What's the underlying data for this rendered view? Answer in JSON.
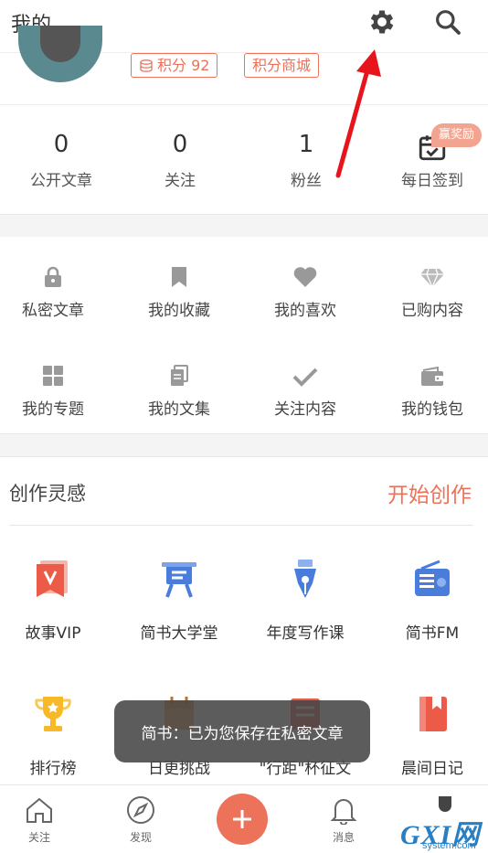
{
  "header": {
    "title": "我的"
  },
  "profile": {
    "points_label": "积分 92",
    "mall_label": "积分商城"
  },
  "stats": [
    {
      "value": "0",
      "label": "公开文章"
    },
    {
      "value": "0",
      "label": "关注"
    },
    {
      "value": "1",
      "label": "粉丝"
    },
    {
      "value": "",
      "label": "每日签到"
    }
  ],
  "reward_badge": "赢奖励",
  "grid": [
    {
      "label": "私密文章",
      "icon": "lock-icon"
    },
    {
      "label": "我的收藏",
      "icon": "bookmark-icon"
    },
    {
      "label": "我的喜欢",
      "icon": "heart-icon"
    },
    {
      "label": "已购内容",
      "icon": "diamond-icon"
    },
    {
      "label": "我的专题",
      "icon": "grid-icon"
    },
    {
      "label": "我的文集",
      "icon": "documents-icon"
    },
    {
      "label": "关注内容",
      "icon": "check-icon"
    },
    {
      "label": "我的钱包",
      "icon": "wallet-icon"
    }
  ],
  "inspiration": {
    "title": "创作灵感",
    "start_label": "开始创作",
    "items": [
      {
        "label": "故事VIP",
        "icon": "vip-book-icon"
      },
      {
        "label": "简书大学堂",
        "icon": "easel-icon"
      },
      {
        "label": "年度写作课",
        "icon": "pen-nib-icon"
      },
      {
        "label": "简书FM",
        "icon": "radio-icon"
      },
      {
        "label": "排行榜",
        "icon": "trophy-icon"
      },
      {
        "label": "日更挑战",
        "icon": "calendar-icon"
      },
      {
        "label": "\"行距\"杯征文",
        "icon": "contest-icon"
      },
      {
        "label": "晨间日记",
        "icon": "diary-icon"
      }
    ]
  },
  "toast": "简书：已为您保存在私密文章",
  "tabbar": [
    {
      "label": "关注"
    },
    {
      "label": "发现"
    },
    {
      "label": "消息"
    }
  ],
  "watermark": {
    "main": "GXI网",
    "sub": "system.com"
  },
  "colors": {
    "accent": "#ec7259",
    "icon_gray": "#999999",
    "watermark": "#2a7fc2"
  }
}
